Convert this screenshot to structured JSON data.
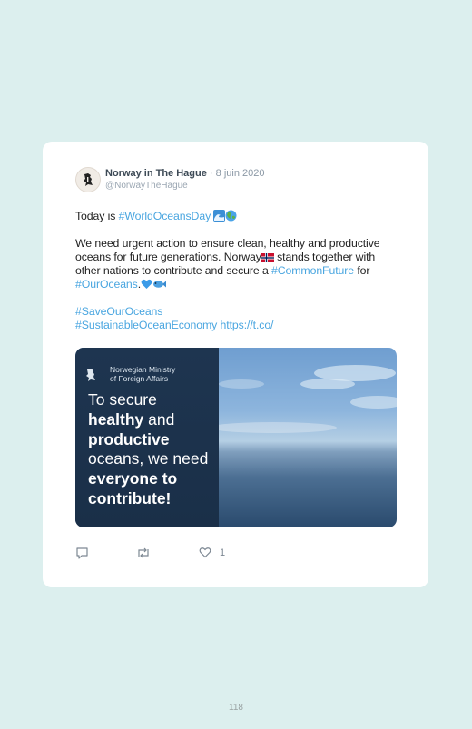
{
  "tweet": {
    "author_name": "Norway in The Hague",
    "date": "· 8 juin 2020",
    "handle": "@NorwayTheHague",
    "line1_prefix": "Today is ",
    "line1_tag": "#WorldOceansDay",
    "para2_text1": "We need urgent action to ensure clean, healthy and productive oceans for future generations. Norway",
    "para2_text2": " stands together with other nations to contribute and secure a ",
    "para2_tag1": "#CommonFuture",
    "para2_for": " for ",
    "para2_tag2": "#OurOceans",
    "para2_dot": ".",
    "tag3": "#SaveOurOceans",
    "tag4": "#SustainableOceanEconomy",
    "url": "https://t.co/",
    "like_count": "1"
  },
  "media": {
    "ministry": "Norwegian Ministry\nof Foreign Affairs",
    "t1": "To secure\n",
    "t2": "healthy",
    "t3": " and\n",
    "t4": "productive",
    "t5": "\noceans, we need\n",
    "t6": "everyone to\ncontribute!"
  },
  "page_number": "118",
  "icons": [
    "avatar-lion-icon",
    "wave-emoji-icon",
    "globe-emoji-icon",
    "norway-flag-icon",
    "blue-heart-icon",
    "fish-icon",
    "reply-icon",
    "retweet-icon",
    "like-icon",
    "ministry-lion-icon"
  ],
  "colors": {
    "background": "#dcefee",
    "link": "#4aa6e0",
    "panel": "#1e3550"
  }
}
